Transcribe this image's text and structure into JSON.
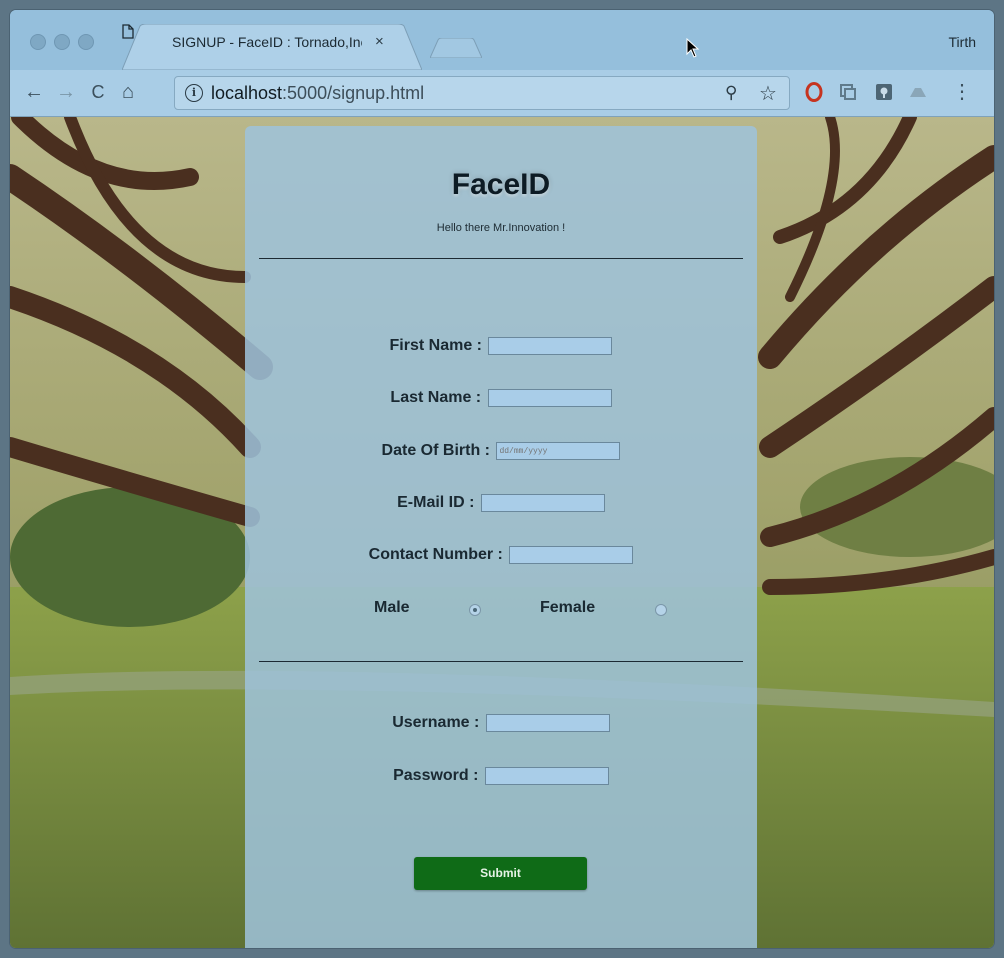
{
  "browser": {
    "tab_title": "SIGNUP - FaceID : Tornado,Inc",
    "tab_close": "×",
    "profile_name": "Tirth",
    "url_host": "localhost",
    "url_rest": ":5000/signup.html"
  },
  "nav": {
    "back": "←",
    "forward": "→",
    "reload": "C",
    "home": "⌂",
    "info": "i",
    "zoom": "⚲",
    "star": "☆",
    "menu": "⋮"
  },
  "page": {
    "brand": "FaceID",
    "tagline": "Hello there Mr.Innovation !",
    "fields": {
      "first_name_label": "First Name : ",
      "last_name_label": "Last Name : ",
      "dob_label": "Date Of Birth : ",
      "dob_placeholder": "dd/mm/yyyy",
      "email_label": "E-Mail ID : ",
      "contact_label": "Contact Number : ",
      "username_label": "Username : ",
      "password_label": "Password : "
    },
    "gender": {
      "male_label": "Male",
      "female_label": "Female",
      "selected": "Male"
    },
    "submit_label": "Submit"
  }
}
